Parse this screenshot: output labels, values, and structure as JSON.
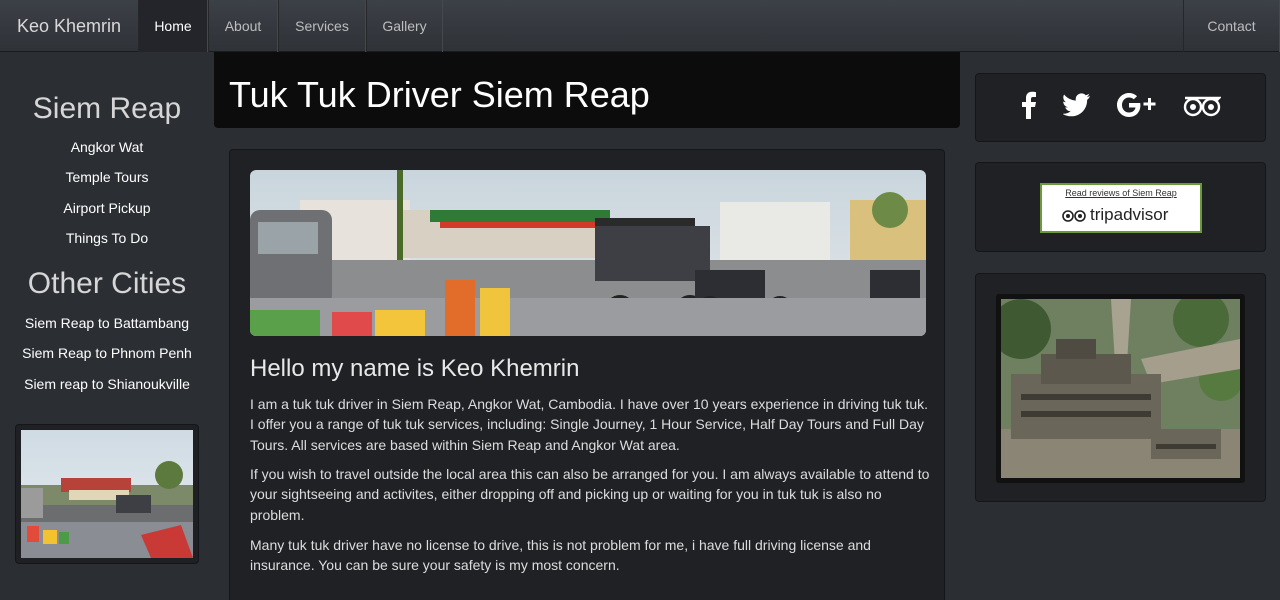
{
  "nav": {
    "brand": "Keo Khemrin",
    "items": [
      "Home",
      "About",
      "Services",
      "Gallery"
    ],
    "contact": "Contact"
  },
  "sidebar": {
    "heading1": "Siem Reap",
    "links1": [
      "Angkor Wat",
      "Temple Tours",
      "Airport Pickup",
      "Things To Do"
    ],
    "heading2": "Other Cities",
    "links2": [
      "Siem Reap to Battambang",
      "Siem Reap to Phnom Penh",
      "Siem reap to Shianoukville"
    ]
  },
  "title": "Tuk Tuk Driver Siem Reap",
  "main": {
    "heading": "Hello my name is Keo Khemrin",
    "paragraphs": [
      "I am a tuk tuk driver in Siem Reap, Angkor Wat, Cambodia. I have over 10 years experience in driving tuk tuk. I offer you a range of tuk tuk services, including: Single Journey, 1 Hour Service, Half Day Tours and Full Day Tours. All services are based within Siem Reap and Angkor Wat area.",
      "If you wish to travel outside the local area this can also be arranged for you. I am always available to attend to your sightseeing and activites, either dropping off and picking up or waiting for you in tuk tuk is also no problem.",
      "Many tuk tuk driver have no license to drive, this is not problem for me, i have full driving license and insurance. You can be sure your safety is my most concern."
    ]
  },
  "tripadvisor": {
    "read_text": "Read reviews of Siem Reap",
    "logo_text": "tripadvisor"
  },
  "icons": {
    "social": [
      "facebook-icon",
      "twitter-icon",
      "google-plus-icon",
      "tripadvisor-icon"
    ]
  }
}
